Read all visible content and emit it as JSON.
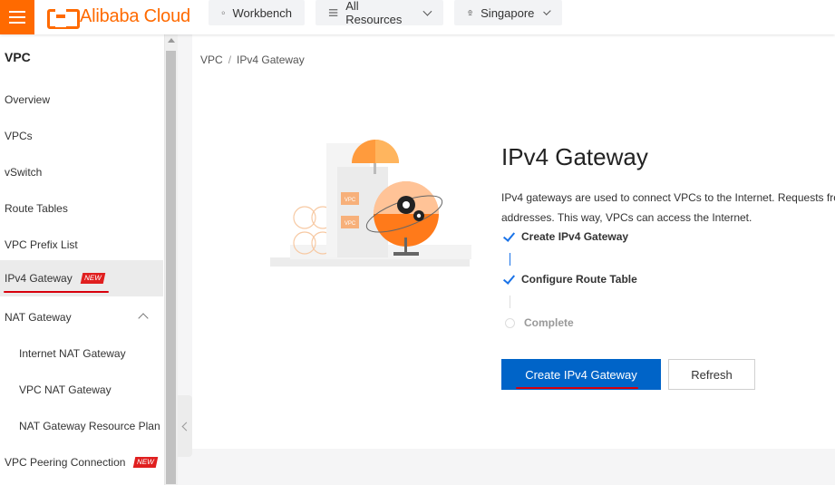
{
  "topbar": {
    "logo_text": "Alibaba Cloud",
    "workbench_label": "Workbench",
    "resources_label": "All Resources",
    "region_label": "Singapore",
    "icons": [
      "menu-icon",
      "home-icon",
      "list-icon",
      "location-pin-icon",
      "chevron-down-icon"
    ],
    "brand_color": "#ff6a00"
  },
  "sidebar": {
    "title": "VPC",
    "items": [
      {
        "label": "Overview"
      },
      {
        "label": "VPCs"
      },
      {
        "label": "vSwitch"
      },
      {
        "label": "Route Tables"
      },
      {
        "label": "VPC Prefix List"
      },
      {
        "label": "IPv4 Gateway",
        "badge": "NEW",
        "active": true
      },
      {
        "label": "NAT Gateway"
      },
      {
        "label": "Internet NAT Gateway"
      },
      {
        "label": "VPC NAT Gateway"
      },
      {
        "label": "NAT Gateway Resource Plan"
      },
      {
        "label": "VPC Peering Connection",
        "badge": "NEW"
      }
    ]
  },
  "main": {
    "breadcrumb": [
      "VPC",
      "IPv4 Gateway"
    ],
    "breadcrumb_sep": "/",
    "title": "IPv4 Gateway",
    "description_line1": "IPv4 gateways are used to connect VPCs to the Internet. Requests fron",
    "description_line2": "addresses. This way, VPCs can access the Internet.",
    "illustration_labels": [
      "VPC",
      "VPC"
    ],
    "steps": [
      {
        "label": "Create IPv4 Gateway",
        "status": "done"
      },
      {
        "label": "Configure Route Table",
        "status": "done"
      },
      {
        "label": "Complete",
        "status": "pending"
      }
    ],
    "create_button": "Create IPv4 Gateway",
    "refresh_button": "Refresh",
    "primary_color": "#0064c8",
    "annotation_color": "#d8000c"
  }
}
